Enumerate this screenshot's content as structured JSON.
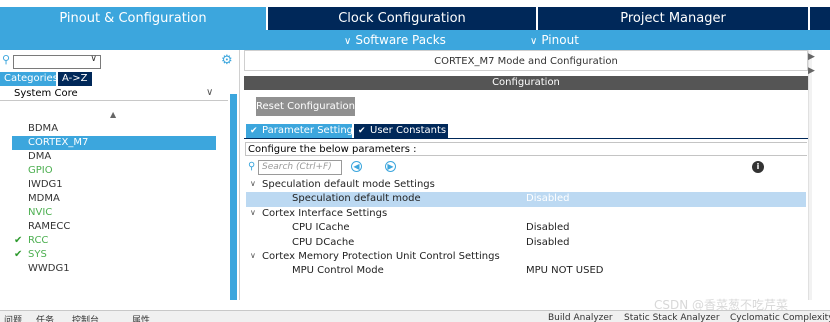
{
  "top_tabs": [
    "Pinout & Configuration",
    "Clock Configuration",
    "Project Manager"
  ],
  "sub_links": [
    "Software Packs",
    "Pinout"
  ],
  "left": {
    "view_tabs": [
      "Categories",
      "A->Z"
    ],
    "group": "System Core",
    "items": [
      {
        "label": "BDMA",
        "state": "normal"
      },
      {
        "label": "CORTEX_M7",
        "state": "selected"
      },
      {
        "label": "DMA",
        "state": "normal"
      },
      {
        "label": "GPIO",
        "state": "green"
      },
      {
        "label": "IWDG1",
        "state": "normal"
      },
      {
        "label": "MDMA",
        "state": "normal"
      },
      {
        "label": "NVIC",
        "state": "green"
      },
      {
        "label": "RAMECC",
        "state": "normal"
      },
      {
        "label": "RCC",
        "state": "checked"
      },
      {
        "label": "SYS",
        "state": "checked"
      },
      {
        "label": "WWDG1",
        "state": "normal"
      }
    ]
  },
  "right": {
    "mode_title": "CORTEX_M7 Mode and Configuration",
    "config_title": "Configuration",
    "reset_label": "Reset Configuration",
    "config_tabs": [
      "Parameter Settings",
      "User Constants"
    ],
    "configure_label": "Configure the below parameters :",
    "search_placeholder": "Search (Ctrl+F)",
    "rows": [
      {
        "type": "group",
        "name": "Speculation default mode Settings"
      },
      {
        "type": "param",
        "name": "Speculation default mode",
        "value": "Disabled",
        "highlight": true
      },
      {
        "type": "group",
        "name": "Cortex Interface Settings"
      },
      {
        "type": "param",
        "name": "CPU ICache",
        "value": "Disabled"
      },
      {
        "type": "param",
        "name": "CPU DCache",
        "value": "Disabled"
      },
      {
        "type": "group",
        "name": "Cortex Memory Protection Unit Control Settings"
      },
      {
        "type": "param",
        "name": "MPU Control Mode",
        "value": "MPU NOT USED"
      }
    ]
  },
  "bottom": {
    "items": [
      "问题",
      "任务",
      "控制台",
      "属性",
      "Build Analyzer",
      "Static Stack Analyzer",
      "Cyclomatic Complexity"
    ]
  },
  "watermark": "CSDN @香菜葱不吃芹菜",
  "colors": {
    "accent": "#3ca6dd",
    "navy": "#002859",
    "selected_row": "#bcd9f2"
  }
}
